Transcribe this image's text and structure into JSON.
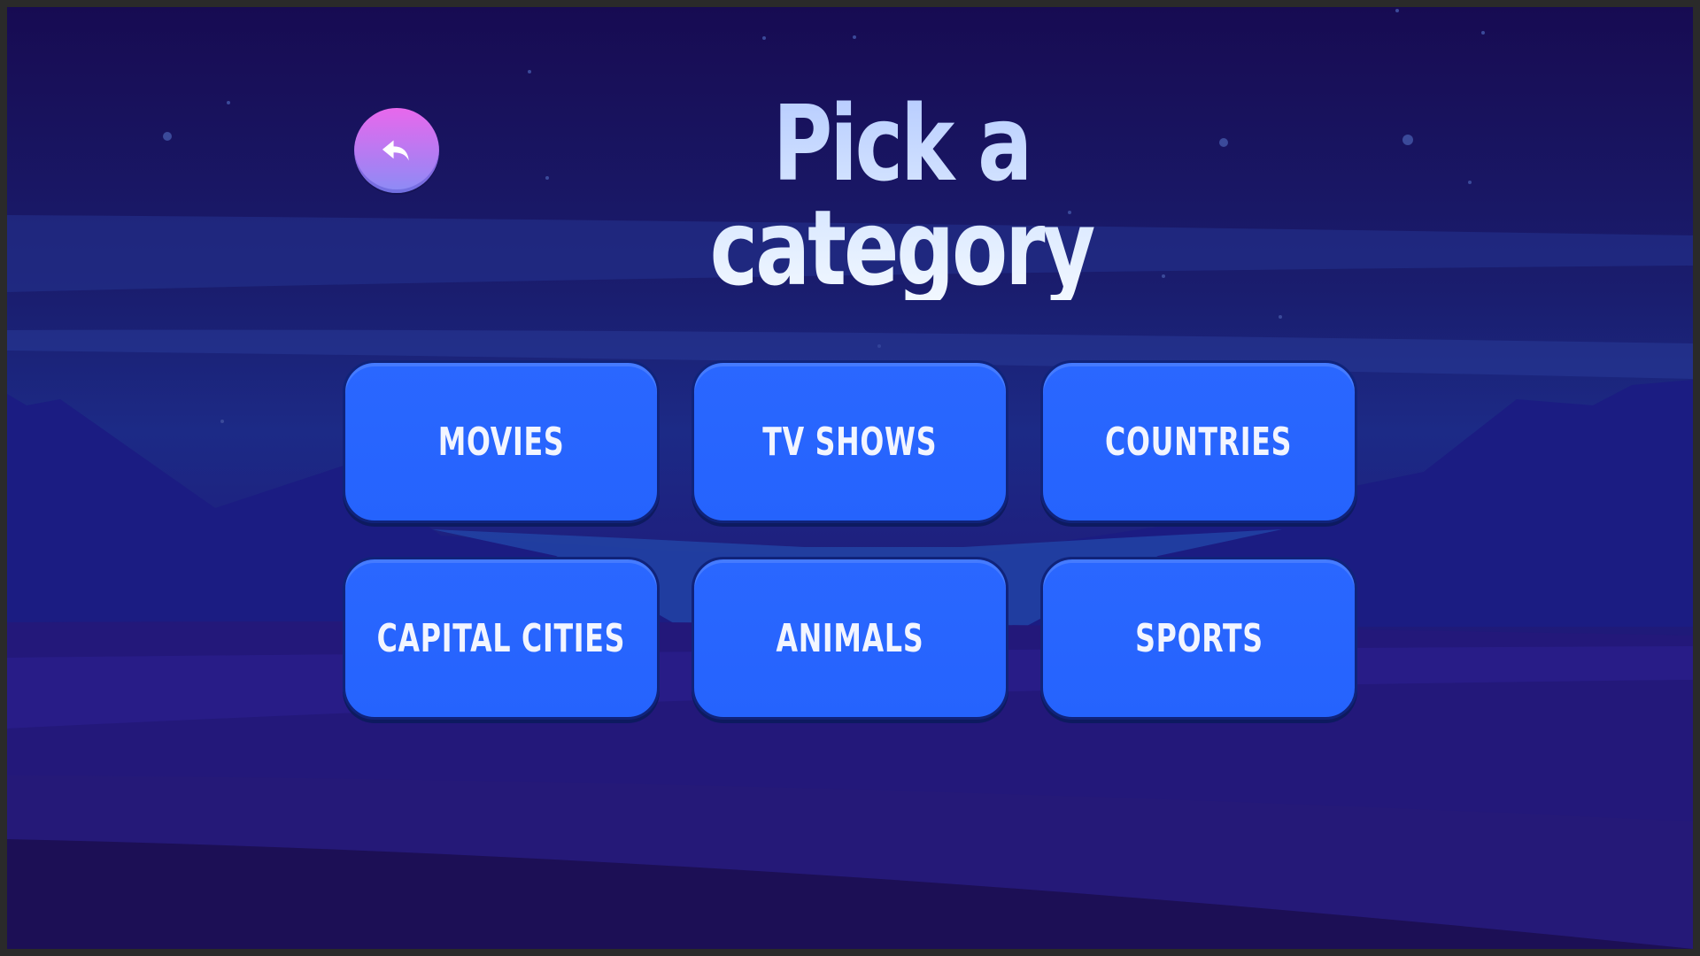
{
  "title": "Pick a category",
  "back_button": {
    "icon": "back-arrow-icon"
  },
  "categories": [
    {
      "label": "MOVIES"
    },
    {
      "label": "TV SHOWS"
    },
    {
      "label": "COUNTRIES"
    },
    {
      "label": "CAPITAL CITIES"
    },
    {
      "label": "ANIMALS"
    },
    {
      "label": "SPORTS"
    }
  ],
  "colors": {
    "background_top": "#170b52",
    "background_bottom": "#1a0c46",
    "button_fill": "#2563fd",
    "button_border": "#10237a",
    "title_color": "#cfe1ff",
    "back_button_top": "#e868ec",
    "back_button_bottom": "#8b8cf6"
  }
}
